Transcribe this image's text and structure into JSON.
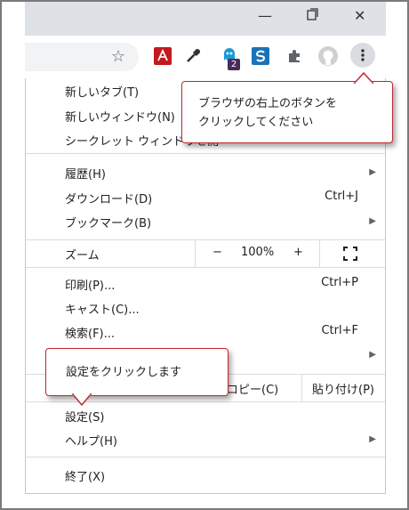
{
  "menu": {
    "new_tab": "新しいタブ(T)",
    "new_window": "新しいウィンドウ(N)",
    "incognito": "シークレット ウィンドウを開",
    "history": "履歴(H)",
    "downloads": "ダウンロード(D)",
    "downloads_shortcut": "Ctrl+J",
    "bookmarks": "ブックマーク(B)",
    "zoom_label": "ズーム",
    "zoom_minus": "−",
    "zoom_value": "100%",
    "zoom_plus": "+",
    "print": "印刷(P)...",
    "print_shortcut": "Ctrl+P",
    "cast": "キャスト(C)...",
    "find": "検索(F)...",
    "find_shortcut": "Ctrl+F",
    "copy": "コピー(C)",
    "paste": "貼り付け(P)",
    "settings": "設定(S)",
    "help": "ヘルプ(H)",
    "exit": "終了(X)"
  },
  "toolbar": {
    "extension_badge": "2"
  },
  "callouts": {
    "top_line1": "ブラウザの右上のボタンを",
    "top_line2": "クリックしてください",
    "bottom": "設定をクリックします"
  },
  "colors": {
    "callout_border": "#c0282f",
    "menu_border": "#c8c8c8",
    "titlebar_bg": "#dee1e6"
  }
}
